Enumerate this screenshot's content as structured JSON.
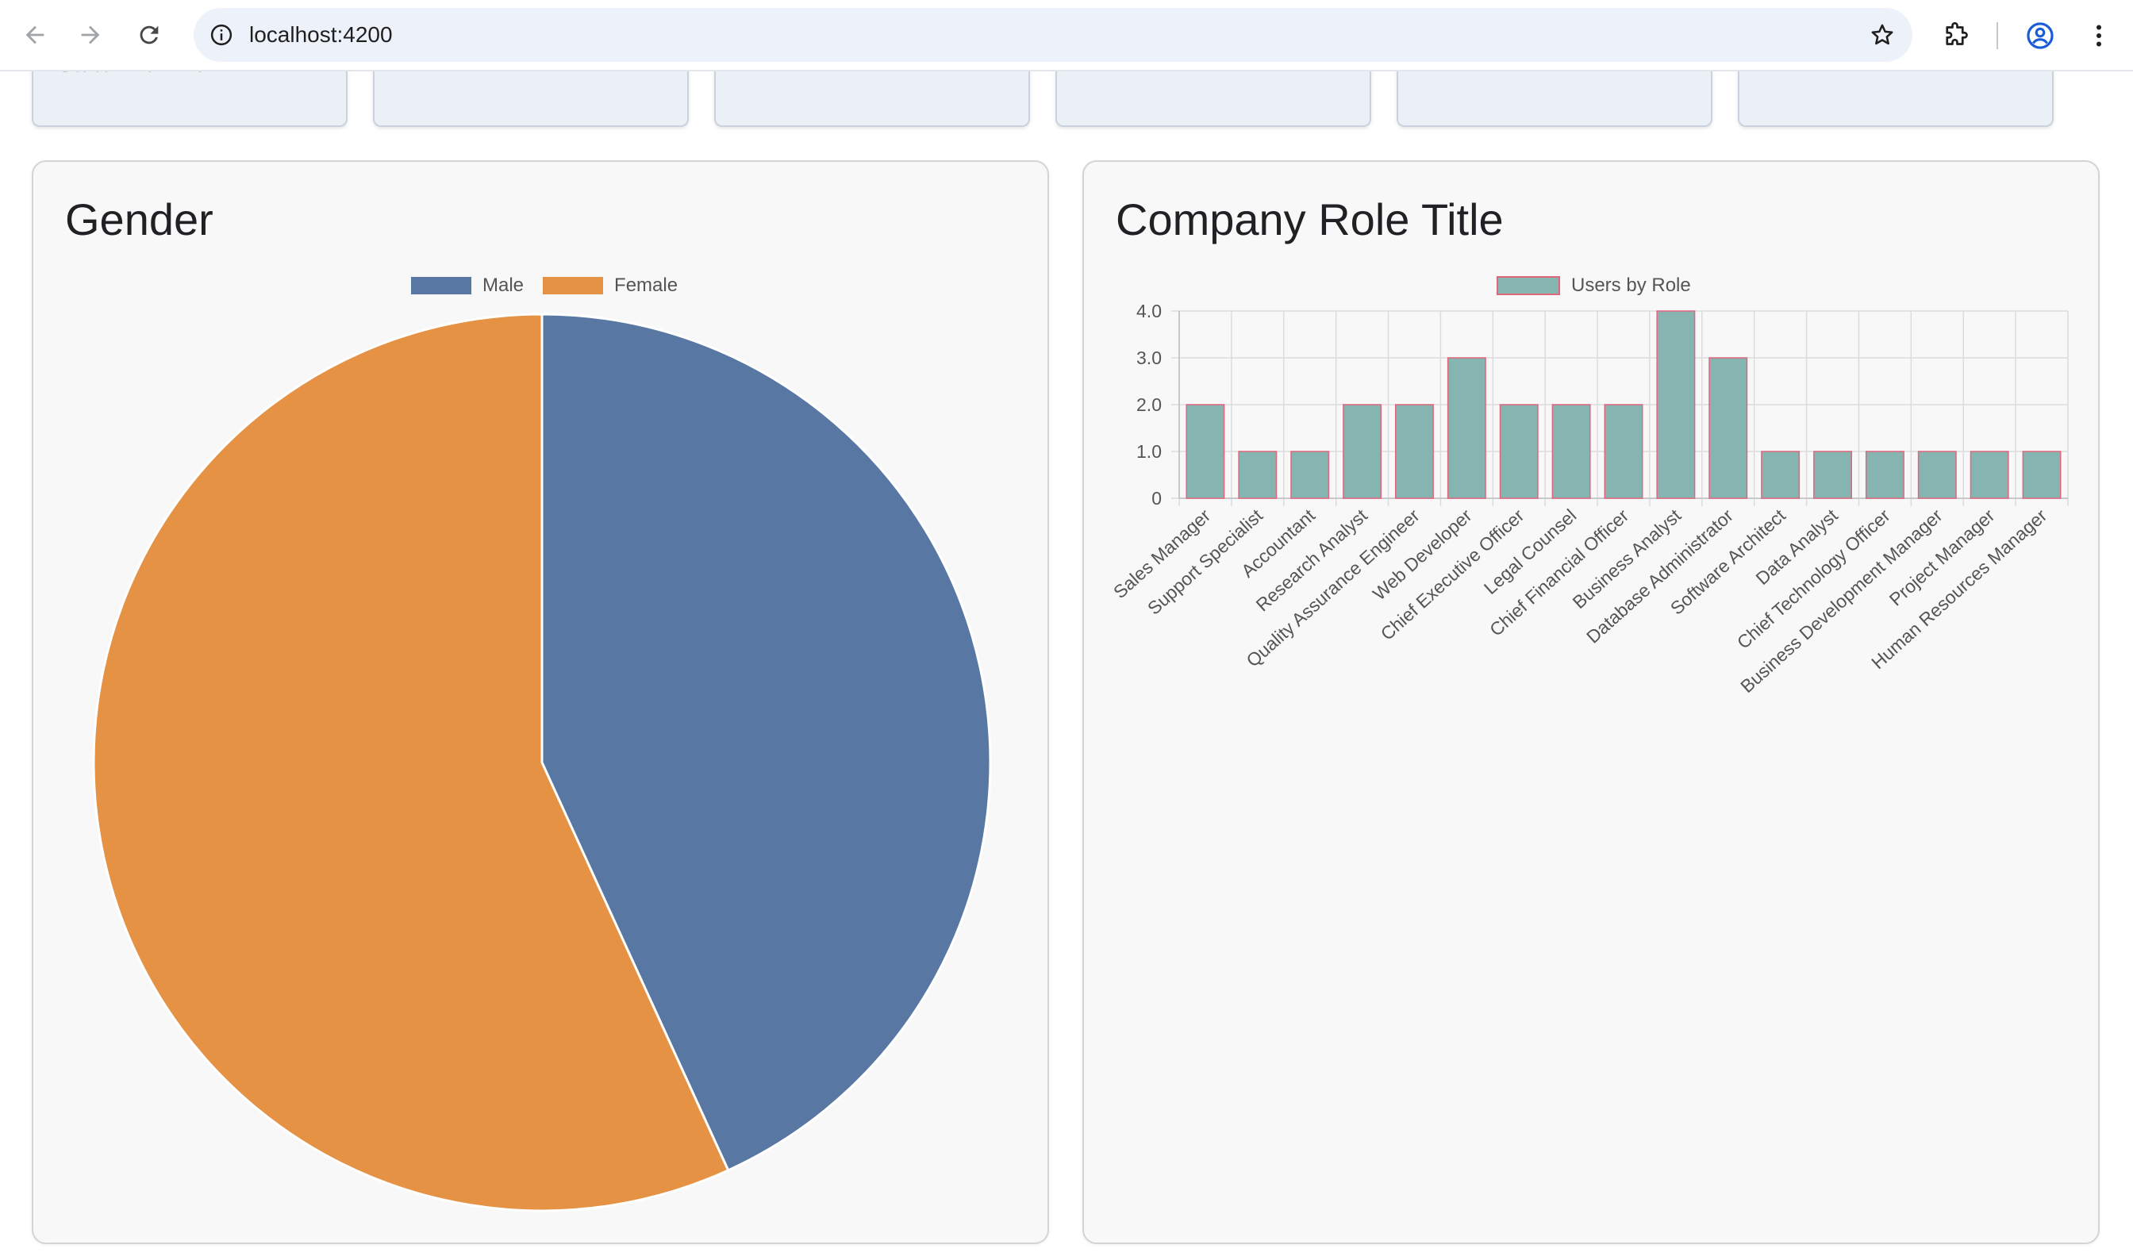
{
  "browser": {
    "url": "localhost:4200"
  },
  "stat_cards": [
    {
      "clipped_text": "State: New York"
    },
    {
      "clipped_text": ""
    },
    {
      "clipped_text": ""
    },
    {
      "clipped_text": ""
    },
    {
      "clipped_text": ""
    },
    {
      "clipped_text": ""
    }
  ],
  "colors": {
    "male": "#5878a3",
    "female": "#e59244",
    "bar_fill": "#86b4b1",
    "bar_border": "#e0667d"
  },
  "gender_panel": {
    "title": "Gender"
  },
  "role_panel": {
    "title": "Company Role Title"
  },
  "chart_data": [
    {
      "type": "pie",
      "title": "Gender",
      "categories": [
        "Male",
        "Female"
      ],
      "values": [
        19,
        25
      ],
      "legend": "top"
    },
    {
      "type": "bar",
      "title": "Company Role Title",
      "series": [
        {
          "name": "Users by Role",
          "values": [
            2,
            1,
            1,
            2,
            2,
            3,
            2,
            2,
            2,
            4,
            3,
            1,
            1,
            1,
            1,
            1,
            1
          ]
        }
      ],
      "categories": [
        "Sales Manager",
        "Support Specialist",
        "Accountant",
        "Research Analyst",
        "Quality Assurance Engineer",
        "Web Developer",
        "Chief Executive Officer",
        "Legal Counsel",
        "Chief Financial Officer",
        "Business Analyst",
        "Database Administrator",
        "Software Architect",
        "Data Analyst",
        "Chief Technology Officer",
        "Business Development Manager",
        "Project Manager",
        "Human Resources Manager"
      ],
      "yticks": [
        "0",
        "1.0",
        "2.0",
        "3.0",
        "4.0"
      ],
      "ylim": [
        0,
        4
      ],
      "grid": true,
      "legend": "top"
    }
  ]
}
